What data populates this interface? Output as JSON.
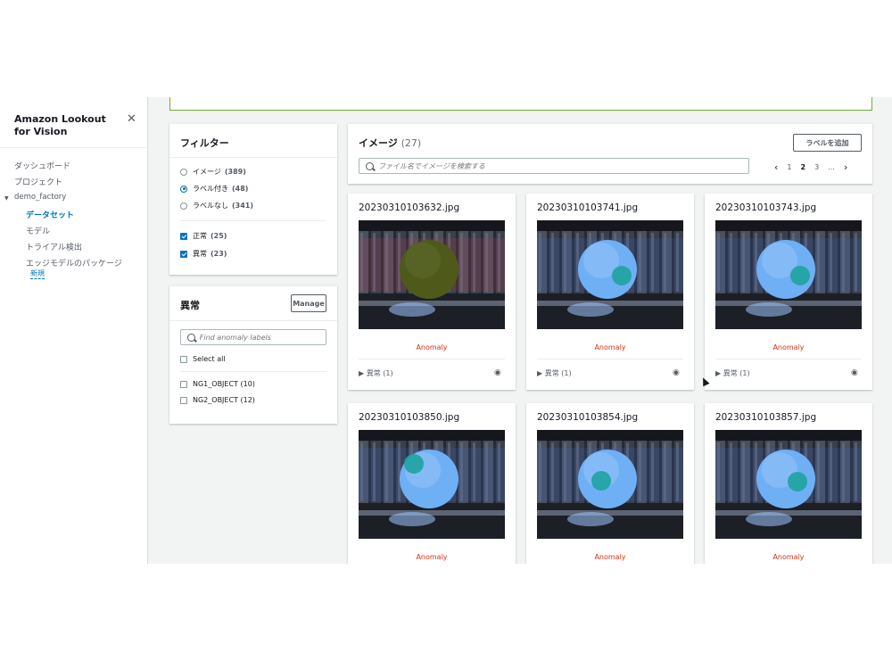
{
  "sidebar": {
    "title": "Amazon Lookout for Vision",
    "items": {
      "dashboard": "ダッシュボード",
      "projects": "プロジェクト",
      "project_name": "demo_factory",
      "dataset": "データセット",
      "model": "モデル",
      "trial": "トライアル検出",
      "edge": "エッジモデルのパッケージ",
      "new_badge": "新規"
    }
  },
  "filter": {
    "title": "フィルター",
    "options": [
      {
        "label": "イメージ",
        "count": "(389)",
        "selected": false
      },
      {
        "label": "ラベル付き",
        "count": "(48)",
        "selected": true
      },
      {
        "label": "ラベルなし",
        "count": "(341)",
        "selected": false
      }
    ],
    "checks": [
      {
        "label": "正常",
        "count": "(25)",
        "checked": true
      },
      {
        "label": "異常",
        "count": "(23)",
        "checked": true
      }
    ]
  },
  "anomaly": {
    "title": "異常",
    "manage_label": "Manage",
    "search_placeholder": "Find anomaly labels",
    "select_all": "Select all",
    "labels": [
      {
        "label": "NG1_OBJECT (10)"
      },
      {
        "label": "NG2_OBJECT (12)"
      }
    ]
  },
  "images": {
    "title": "イメージ",
    "count": "(27)",
    "add_label_button": "ラベルを追加",
    "search_placeholder": "ファイル名でイメージを検索する",
    "pagination": {
      "prev": "‹",
      "pages": [
        "1",
        "2",
        "3",
        "..."
      ],
      "current": "2",
      "next": "›"
    },
    "cards": [
      {
        "name": "20230310103632.jpg",
        "status": "Anomaly",
        "label": "異常 (1)",
        "disc": "olive",
        "spot": false
      },
      {
        "name": "20230310103741.jpg",
        "status": "Anomaly",
        "label": "異常 (1)",
        "disc": "blue",
        "spot": "right"
      },
      {
        "name": "20230310103743.jpg",
        "status": "Anomaly",
        "label": "異常 (1)",
        "disc": "blue",
        "spot": "right"
      },
      {
        "name": "20230310103850.jpg",
        "status": "Anomaly",
        "label": "",
        "disc": "blue",
        "spot": "left"
      },
      {
        "name": "20230310103854.jpg",
        "status": "Anomaly",
        "label": "",
        "disc": "blue",
        "spot": "center"
      },
      {
        "name": "20230310103857.jpg",
        "status": "Anomaly",
        "label": "",
        "disc": "blue",
        "spot": "lower-right"
      }
    ],
    "expand_icon": "caret-right-icon",
    "view_icon": "eye-icon"
  },
  "colors": {
    "accent": "#0073bb",
    "anomaly": "#d13212",
    "disc_blue": "#6fb0f5",
    "disc_olive": "#4f5a1a",
    "spot": "#1ea3a0"
  }
}
